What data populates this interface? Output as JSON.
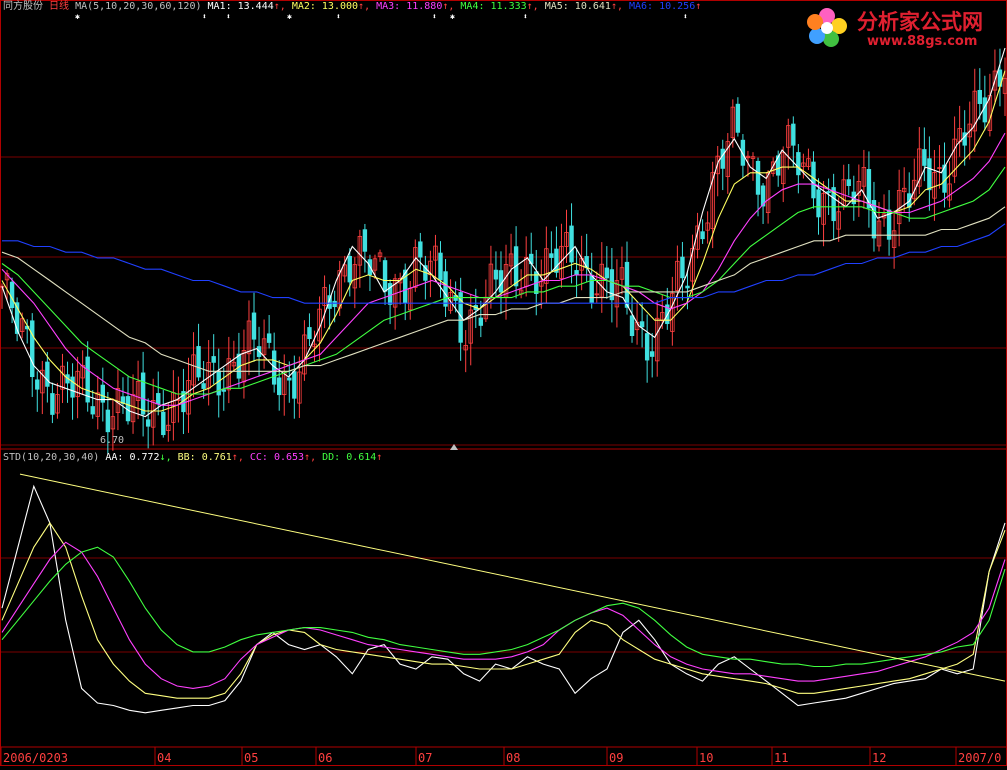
{
  "app": {
    "stock_name": "同方股份",
    "period": "日线",
    "watermark_name": "分析家公式网",
    "watermark_url": "www.88gs.com"
  },
  "colors": {
    "background": "#000000",
    "grid": "#7a0000",
    "axis": "#b00000",
    "label": "#c0c0c0",
    "up": "#ff4040",
    "down": "#40e0e0",
    "ma1": "#ffffff",
    "ma2": "#ffff60",
    "ma3": "#ff40ff",
    "ma4": "#40ff40",
    "ma5": "#e0e0c0",
    "ma6": "#2040ff",
    "std_aa": "#ffffff",
    "std_bb": "#ffff80",
    "std_cc": "#ff40ff",
    "std_dd": "#40ff40",
    "trend": "#ffff80"
  },
  "main_legend": {
    "prefix": "MA(5,10,20,30,60,120)",
    "items": [
      {
        "label": "MA1:",
        "value": "13.444",
        "arrow": "↑",
        "color": "#ffffff"
      },
      {
        "label": "MA2:",
        "value": "13.000",
        "arrow": "↑",
        "color": "#ffff60"
      },
      {
        "label": "MA3:",
        "value": "11.880",
        "arrow": "↑",
        "color": "#ff40ff"
      },
      {
        "label": "MA4:",
        "value": "11.333",
        "arrow": "↑",
        "color": "#40ff40"
      },
      {
        "label": "MA5:",
        "value": "10.641",
        "arrow": "↑",
        "color": "#e0e0c0"
      },
      {
        "label": "MA6:",
        "value": "10.256",
        "arrow": "↑",
        "color": "#2040ff"
      }
    ]
  },
  "sub_legend": {
    "prefix": "STD(10,20,30,40)",
    "items": [
      {
        "label": "AA:",
        "value": "0.772",
        "arrow": "↓",
        "color": "#ffffff"
      },
      {
        "label": "BB:",
        "value": "0.761",
        "arrow": "↑",
        "color": "#ffff80"
      },
      {
        "label": "CC:",
        "value": "0.653",
        "arrow": "↑",
        "color": "#ff40ff"
      },
      {
        "label": "DD:",
        "value": "0.614",
        "arrow": "↑",
        "color": "#40ff40"
      }
    ]
  },
  "low_marker": "6.70",
  "x_axis_labels": [
    "2006/0203",
    "04",
    "05",
    "06",
    "07",
    "08",
    "09",
    "10",
    "11",
    "12",
    "2007/0"
  ],
  "chart_data": [
    {
      "type": "line",
      "title": "",
      "series": [
        {
          "name": "MA1",
          "values": [
            9.2,
            8.4,
            7.8,
            7.5,
            7.4,
            7.3,
            7.2,
            7.2,
            7.0,
            6.9,
            7.1,
            7.2,
            7.4,
            7.6,
            7.8,
            8.0,
            8.1,
            7.8,
            7.6,
            7.9,
            8.5,
            9.3,
            9.9,
            9.6,
            9.1,
            9.3,
            9.7,
            9.4,
            9.0,
            8.6,
            8.8,
            9.1,
            9.5,
            9.7,
            9.3,
            9.6,
            9.9,
            9.4,
            9.1,
            9.0,
            8.5,
            8.3,
            8.8,
            9.4,
            10.5,
            11.4,
            11.8,
            11.3,
            11.1,
            11.6,
            11.3,
            11.0,
            10.8,
            10.6,
            10.9,
            10.4,
            10.5,
            10.7,
            11.3,
            11.2,
            11.7,
            12.0,
            12.5,
            13.4
          ]
        },
        {
          "name": "MA2",
          "values": [
            9.3,
            8.8,
            8.3,
            7.9,
            7.6,
            7.4,
            7.3,
            7.2,
            7.1,
            7.0,
            7.0,
            7.1,
            7.3,
            7.4,
            7.6,
            7.8,
            7.9,
            7.9,
            7.8,
            7.9,
            8.2,
            8.7,
            9.3,
            9.4,
            9.3,
            9.3,
            9.5,
            9.4,
            9.2,
            8.9,
            8.8,
            9.0,
            9.2,
            9.4,
            9.4,
            9.5,
            9.6,
            9.5,
            9.3,
            9.2,
            8.9,
            8.6,
            8.6,
            8.9,
            9.6,
            10.4,
            11.0,
            11.2,
            11.2,
            11.3,
            11.3,
            11.1,
            10.9,
            10.7,
            10.7,
            10.6,
            10.5,
            10.6,
            10.9,
            11.0,
            11.3,
            11.6,
            12.1,
            13.0
          ]
        },
        {
          "name": "MA3",
          "values": [
            9.5,
            9.2,
            8.9,
            8.5,
            8.1,
            7.8,
            7.6,
            7.4,
            7.3,
            7.2,
            7.1,
            7.1,
            7.2,
            7.3,
            7.4,
            7.5,
            7.6,
            7.7,
            7.8,
            7.9,
            8.0,
            8.3,
            8.6,
            8.9,
            9.0,
            9.1,
            9.2,
            9.3,
            9.2,
            9.1,
            9.0,
            9.0,
            9.1,
            9.2,
            9.3,
            9.3,
            9.4,
            9.4,
            9.3,
            9.2,
            9.1,
            8.9,
            8.8,
            8.9,
            9.1,
            9.5,
            10.0,
            10.4,
            10.7,
            10.9,
            11.0,
            11.0,
            10.9,
            10.8,
            10.7,
            10.6,
            10.5,
            10.5,
            10.6,
            10.7,
            10.9,
            11.1,
            11.4,
            11.9
          ]
        },
        {
          "name": "MA4",
          "values": [
            9.6,
            9.4,
            9.1,
            8.8,
            8.5,
            8.2,
            8.0,
            7.8,
            7.6,
            7.5,
            7.4,
            7.3,
            7.3,
            7.3,
            7.4,
            7.4,
            7.5,
            7.6,
            7.7,
            7.8,
            7.9,
            8.0,
            8.2,
            8.4,
            8.6,
            8.7,
            8.8,
            8.9,
            9.0,
            9.0,
            9.0,
            9.0,
            9.0,
            9.1,
            9.1,
            9.2,
            9.2,
            9.3,
            9.3,
            9.2,
            9.2,
            9.1,
            9.0,
            9.0,
            9.1,
            9.3,
            9.6,
            9.9,
            10.1,
            10.3,
            10.5,
            10.6,
            10.6,
            10.6,
            10.6,
            10.5,
            10.5,
            10.4,
            10.4,
            10.5,
            10.6,
            10.7,
            10.9,
            11.3
          ]
        },
        {
          "name": "MA5",
          "values": [
            9.8,
            9.7,
            9.5,
            9.3,
            9.1,
            8.9,
            8.7,
            8.5,
            8.3,
            8.2,
            8.0,
            7.9,
            7.8,
            7.7,
            7.7,
            7.7,
            7.7,
            7.7,
            7.7,
            7.8,
            7.8,
            7.9,
            8.0,
            8.1,
            8.2,
            8.3,
            8.4,
            8.5,
            8.6,
            8.6,
            8.7,
            8.7,
            8.8,
            8.8,
            8.9,
            8.9,
            9.0,
            9.0,
            9.0,
            9.1,
            9.1,
            9.1,
            9.1,
            9.1,
            9.2,
            9.3,
            9.4,
            9.6,
            9.7,
            9.8,
            9.9,
            10.0,
            10.0,
            10.1,
            10.1,
            10.1,
            10.1,
            10.1,
            10.1,
            10.2,
            10.2,
            10.3,
            10.4,
            10.6
          ]
        },
        {
          "name": "MA6",
          "values": [
            10.0,
            10.0,
            9.9,
            9.9,
            9.8,
            9.8,
            9.7,
            9.7,
            9.6,
            9.5,
            9.5,
            9.4,
            9.3,
            9.3,
            9.2,
            9.1,
            9.1,
            9.0,
            9.0,
            8.9,
            8.9,
            8.9,
            8.9,
            8.9,
            8.9,
            8.9,
            8.9,
            8.9,
            8.9,
            8.9,
            8.9,
            8.9,
            8.9,
            8.9,
            8.9,
            8.9,
            8.9,
            8.9,
            8.9,
            8.9,
            8.9,
            8.9,
            9.0,
            9.0,
            9.0,
            9.1,
            9.1,
            9.2,
            9.3,
            9.3,
            9.4,
            9.4,
            9.5,
            9.6,
            9.6,
            9.7,
            9.7,
            9.8,
            9.8,
            9.9,
            9.9,
            10.0,
            10.1,
            10.3
          ]
        }
      ],
      "price_range": [
        6.4,
        14.0
      ]
    },
    {
      "type": "line",
      "title": "",
      "series": [
        {
          "name": "AA",
          "values": [
            0.45,
            0.7,
            0.95,
            0.8,
            0.4,
            0.12,
            0.06,
            0.05,
            0.03,
            0.02,
            0.03,
            0.04,
            0.05,
            0.05,
            0.07,
            0.15,
            0.3,
            0.35,
            0.3,
            0.28,
            0.3,
            0.25,
            0.18,
            0.28,
            0.3,
            0.22,
            0.2,
            0.25,
            0.24,
            0.18,
            0.15,
            0.22,
            0.2,
            0.25,
            0.22,
            0.2,
            0.1,
            0.16,
            0.2,
            0.35,
            0.4,
            0.32,
            0.22,
            0.18,
            0.15,
            0.22,
            0.25,
            0.2,
            0.15,
            0.1,
            0.05,
            0.06,
            0.07,
            0.08,
            0.1,
            0.12,
            0.14,
            0.15,
            0.16,
            0.2,
            0.18,
            0.2,
            0.6,
            0.8
          ]
        },
        {
          "name": "BB",
          "values": [
            0.4,
            0.55,
            0.7,
            0.8,
            0.7,
            0.5,
            0.32,
            0.22,
            0.15,
            0.1,
            0.09,
            0.08,
            0.08,
            0.08,
            0.1,
            0.18,
            0.3,
            0.34,
            0.36,
            0.35,
            0.3,
            0.28,
            0.27,
            0.26,
            0.25,
            0.24,
            0.23,
            0.22,
            0.22,
            0.21,
            0.2,
            0.2,
            0.2,
            0.22,
            0.24,
            0.26,
            0.35,
            0.4,
            0.38,
            0.32,
            0.28,
            0.24,
            0.22,
            0.2,
            0.18,
            0.17,
            0.16,
            0.15,
            0.14,
            0.12,
            0.1,
            0.1,
            0.11,
            0.12,
            0.13,
            0.14,
            0.15,
            0.16,
            0.18,
            0.2,
            0.22,
            0.26,
            0.6,
            0.77
          ]
        },
        {
          "name": "CC",
          "values": [
            0.35,
            0.45,
            0.55,
            0.65,
            0.72,
            0.68,
            0.58,
            0.45,
            0.32,
            0.22,
            0.16,
            0.13,
            0.12,
            0.13,
            0.16,
            0.24,
            0.3,
            0.33,
            0.36,
            0.37,
            0.36,
            0.34,
            0.32,
            0.3,
            0.29,
            0.28,
            0.27,
            0.26,
            0.25,
            0.24,
            0.24,
            0.24,
            0.25,
            0.27,
            0.3,
            0.36,
            0.4,
            0.43,
            0.45,
            0.42,
            0.36,
            0.3,
            0.25,
            0.22,
            0.2,
            0.19,
            0.18,
            0.18,
            0.17,
            0.16,
            0.15,
            0.15,
            0.16,
            0.17,
            0.18,
            0.19,
            0.21,
            0.23,
            0.25,
            0.28,
            0.31,
            0.35,
            0.45,
            0.65
          ]
        },
        {
          "name": "DD",
          "values": [
            0.32,
            0.4,
            0.48,
            0.56,
            0.63,
            0.68,
            0.7,
            0.66,
            0.56,
            0.45,
            0.36,
            0.3,
            0.27,
            0.27,
            0.29,
            0.32,
            0.34,
            0.35,
            0.36,
            0.37,
            0.37,
            0.36,
            0.35,
            0.33,
            0.32,
            0.3,
            0.29,
            0.28,
            0.27,
            0.26,
            0.26,
            0.27,
            0.28,
            0.3,
            0.33,
            0.36,
            0.4,
            0.43,
            0.46,
            0.47,
            0.45,
            0.4,
            0.34,
            0.29,
            0.26,
            0.25,
            0.24,
            0.24,
            0.23,
            0.22,
            0.22,
            0.21,
            0.21,
            0.22,
            0.22,
            0.23,
            0.24,
            0.25,
            0.26,
            0.27,
            0.29,
            0.3,
            0.4,
            0.61
          ]
        }
      ],
      "range": [
        -0.1,
        1.05
      ]
    }
  ]
}
